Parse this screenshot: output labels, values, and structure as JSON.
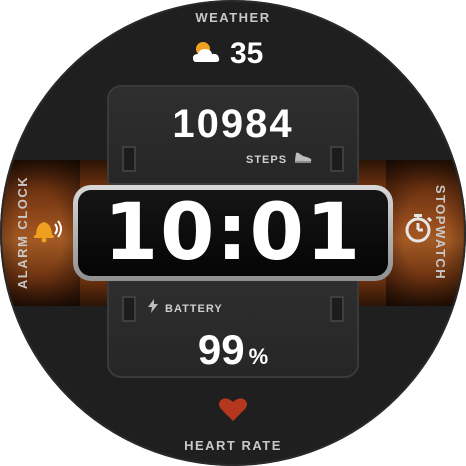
{
  "watch_face": {
    "labels": {
      "weather": "WEATHER",
      "heart_rate": "HEART RATE",
      "alarm_clock": "ALARM CLOCK",
      "stopwatch": "STOPWATCH"
    },
    "weather": {
      "temperature": "35",
      "icon": "partly-cloudy-icon"
    },
    "steps": {
      "value": "10984",
      "label": "STEPS",
      "icon": "shoe-icon"
    },
    "time": {
      "display": "10:01"
    },
    "battery": {
      "label": "BATTERY",
      "value": "99",
      "unit": "%",
      "icon": "lightning-icon"
    },
    "icons": {
      "alarm": "alarm-bell-icon",
      "stopwatch": "stopwatch-icon",
      "heart": "heart-icon"
    },
    "colors": {
      "band": "#9a4e1d",
      "background": "#1f1f1f",
      "text": "#ffffff",
      "heart": "#b5381e",
      "sun": "#f0a020"
    }
  }
}
